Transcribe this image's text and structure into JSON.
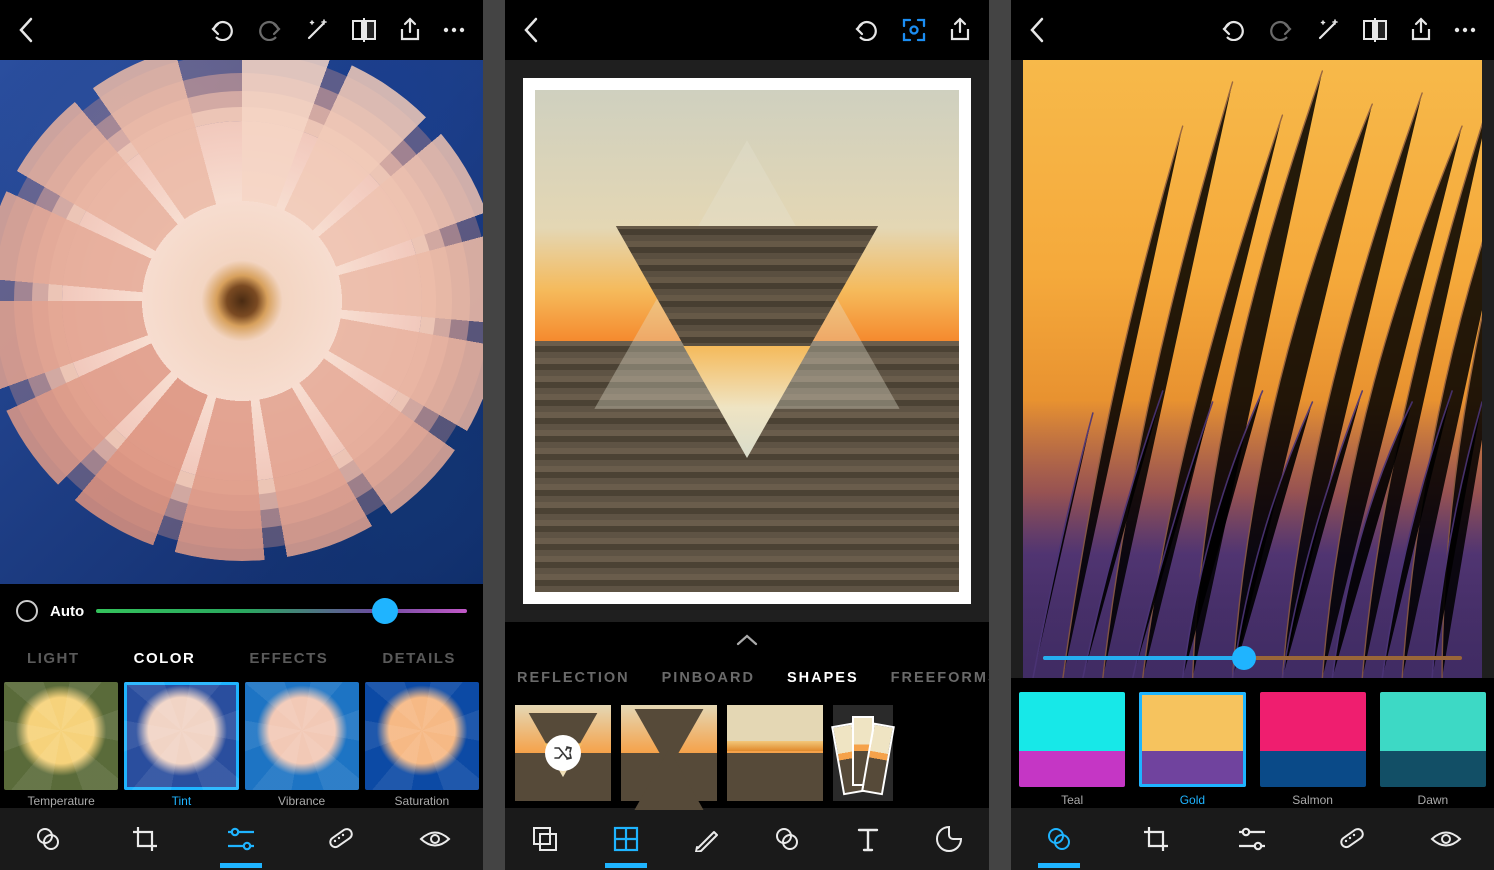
{
  "screen1": {
    "auto_label": "Auto",
    "slider_percent": 78,
    "tabs": [
      "LIGHT",
      "COLOR",
      "EFFECTS",
      "DETAILS"
    ],
    "active_tab": "COLOR",
    "thumbs": [
      {
        "label": "Temperature",
        "active": false
      },
      {
        "label": "Tint",
        "active": true
      },
      {
        "label": "Vibrance",
        "active": false
      },
      {
        "label": "Saturation",
        "active": false
      }
    ],
    "tools": [
      "looks",
      "crop",
      "adjust",
      "heal",
      "redeye"
    ],
    "active_tool": "adjust"
  },
  "screen2": {
    "tabs": [
      "REFLECTION",
      "PINBOARD",
      "SHAPES",
      "FREEFORMS"
    ],
    "active_tab": "SHAPES",
    "presets": 4,
    "active_preset": 0,
    "tools": [
      "layers",
      "grid",
      "draw",
      "looks",
      "text",
      "sticker"
    ],
    "active_tool": "grid"
  },
  "screen3": {
    "slider_percent": 48,
    "filters": [
      {
        "label": "Teal",
        "active": false,
        "colors": [
          "#17e8e8",
          "#c536c5"
        ]
      },
      {
        "label": "Gold",
        "active": true,
        "colors": [
          "#f6c35e",
          "#70439e"
        ]
      },
      {
        "label": "Salmon",
        "active": false,
        "colors": [
          "#ef1e6f",
          "#0a4a88"
        ]
      },
      {
        "label": "Dawn",
        "active": false,
        "colors": [
          "#3dd9c5",
          "#124f66"
        ]
      }
    ],
    "tools": [
      "looks",
      "crop",
      "adjust",
      "heal",
      "redeye"
    ],
    "active_tool": "looks"
  },
  "colors": {
    "accent": "#1fb4ff"
  }
}
